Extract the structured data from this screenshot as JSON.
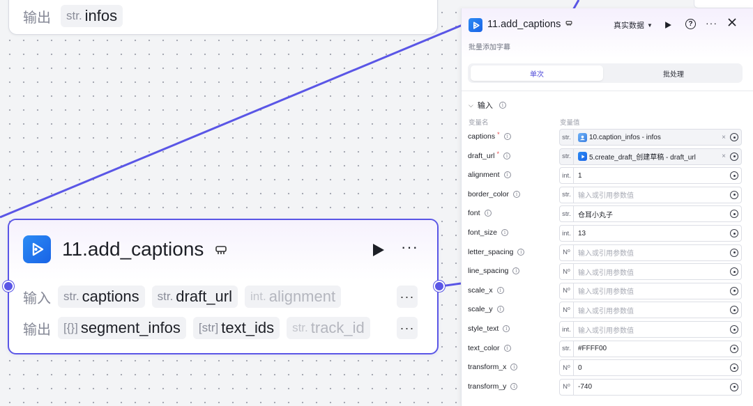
{
  "canvas": {
    "top_node": {
      "output_label": "输出",
      "outputs": [
        {
          "type": "str.",
          "name": "infos"
        }
      ]
    },
    "main_node": {
      "title": "11.add_captions",
      "input_label": "输入",
      "output_label": "输出",
      "inputs": [
        {
          "type": "str.",
          "name": "captions"
        },
        {
          "type": "str.",
          "name": "draft_url"
        },
        {
          "type": "int.",
          "name": "alignment"
        }
      ],
      "outputs": [
        {
          "type": "[{}]",
          "name": "segment_infos"
        },
        {
          "type": "[str]",
          "name": "text_ids"
        },
        {
          "type": "str.",
          "name": "track_id"
        }
      ],
      "more": "···"
    }
  },
  "panel": {
    "title": "11.add_captions",
    "description": "批量添加字幕",
    "data_mode": "真实数据",
    "more": "···",
    "tabs": [
      {
        "label": "单次",
        "active": true
      },
      {
        "label": "批处理",
        "active": false
      }
    ],
    "section_label": "输入",
    "col_name": "变量名",
    "col_value": "变量值",
    "params": [
      {
        "name": "captions",
        "required": true,
        "type": "str.",
        "value": "10.caption_infos - infos",
        "ref": true,
        "ref_icon": "image-icon",
        "clearable": true
      },
      {
        "name": "draft_url",
        "required": true,
        "type": "str.",
        "value": "5.create_draft_创建草稿 - draft_url",
        "ref": true,
        "ref_icon": "play-app-icon",
        "clearable": true
      },
      {
        "name": "alignment",
        "required": false,
        "type": "int.",
        "value": "1"
      },
      {
        "name": "border_color",
        "required": false,
        "type": "str.",
        "value": "",
        "placeholder": "输入或引用参数值"
      },
      {
        "name": "font",
        "required": false,
        "type": "str.",
        "value": "仓耳小丸子"
      },
      {
        "name": "font_size",
        "required": false,
        "type": "int.",
        "value": "13"
      },
      {
        "name": "letter_spacing",
        "required": false,
        "type": "N⁰",
        "value": "",
        "placeholder": "输入或引用参数值"
      },
      {
        "name": "line_spacing",
        "required": false,
        "type": "N⁰",
        "value": "",
        "placeholder": "输入或引用参数值"
      },
      {
        "name": "scale_x",
        "required": false,
        "type": "N⁰",
        "value": "",
        "placeholder": "输入或引用参数值"
      },
      {
        "name": "scale_y",
        "required": false,
        "type": "N⁰",
        "value": "",
        "placeholder": "输入或引用参数值"
      },
      {
        "name": "style_text",
        "required": false,
        "type": "int.",
        "value": "",
        "placeholder": "输入或引用参数值"
      },
      {
        "name": "text_color",
        "required": false,
        "type": "str.",
        "value": "#FFFF00"
      },
      {
        "name": "transform_x",
        "required": false,
        "type": "N⁰",
        "value": "0"
      },
      {
        "name": "transform_y",
        "required": false,
        "type": "N⁰",
        "value": "-740"
      }
    ]
  },
  "colors": {
    "accent": "#5a56e6",
    "brand_icon": "#1963e6",
    "required": "#e5484d"
  }
}
